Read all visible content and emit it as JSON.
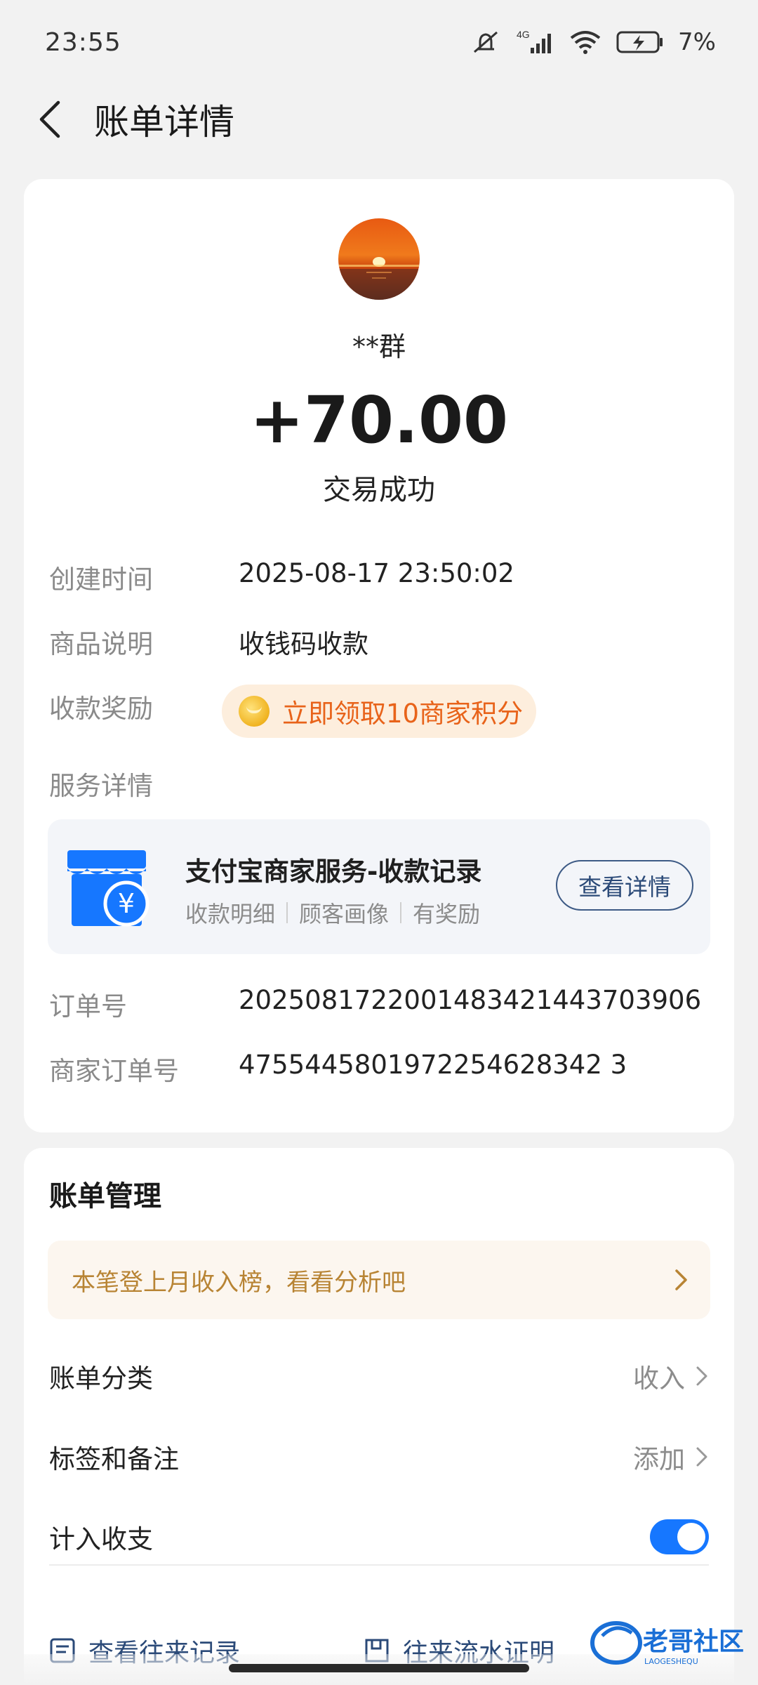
{
  "status_bar": {
    "time": "23:55",
    "network": "4G",
    "battery": "7%",
    "icons": [
      "mute-icon",
      "signal-icon",
      "wifi-icon",
      "battery-icon"
    ]
  },
  "header": {
    "title": "账单详情"
  },
  "transaction": {
    "payer": "**群",
    "amount": "+70.00",
    "status": "交易成功"
  },
  "details": {
    "created_label": "创建时间",
    "created_value": "2025-08-17 23:50:02",
    "desc_label": "商品说明",
    "desc_value": "收钱码收款",
    "reward_label": "收款奖励",
    "reward_value": "立即领取10商家积分",
    "service_label": "服务详情",
    "order_label": "订单号",
    "order_value": "2025081722001483421443703906",
    "merchant_order_label": "商家订单号",
    "merchant_order_value": "4755445801972254628342 3"
  },
  "service": {
    "title": "支付宝商家服务-收款记录",
    "tags": [
      "收款明细",
      "顾客画像",
      "有奖励"
    ],
    "button": "查看详情"
  },
  "manage": {
    "title": "账单管理",
    "banner": "本笔登上月收入榜，看看分析吧",
    "category_label": "账单分类",
    "category_value": "收入",
    "tags_label": "标签和备注",
    "tags_value": "添加",
    "include_label": "计入收支",
    "include_enabled": true,
    "link_history": "查看往来记录",
    "link_proof": "往来流水证明"
  },
  "watermark": {
    "text": "老哥社区",
    "subtext": "LAOGESHEQU"
  },
  "colors": {
    "accent": "#1677ff",
    "reward": "#e8631a",
    "banner_text": "#b88434",
    "link": "#2b4a78"
  }
}
